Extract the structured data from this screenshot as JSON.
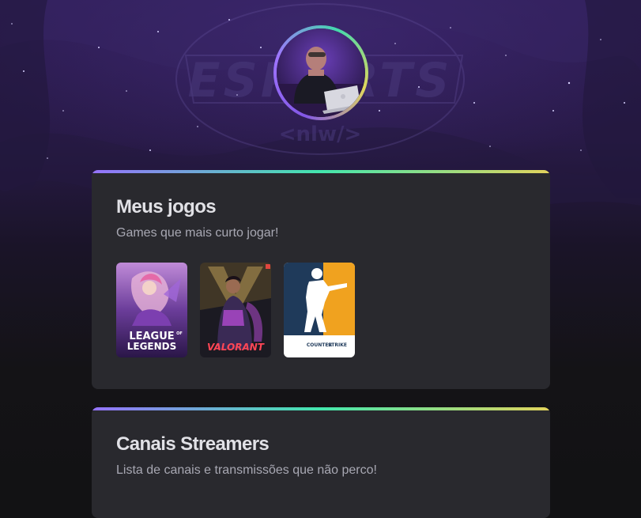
{
  "background": {
    "logo_text": "ESPORTS",
    "logo_sub": "<nlw/>"
  },
  "profile": {
    "avatar_alt": "avatar"
  },
  "colors": {
    "accent_purple": "#8257e5",
    "accent_green": "#43e7ad",
    "accent_yellow": "#e2d45c",
    "card_bg": "#29292e",
    "page_bg": "#121214"
  },
  "sections": [
    {
      "title": "Meus jogos",
      "subtitle": "Games que mais curto jogar!",
      "games": [
        {
          "name": "League of Legends",
          "line1": "LEAGUE",
          "of": "OF",
          "line2": "LEGENDS"
        },
        {
          "name": "Valorant",
          "label": "VALORANT"
        },
        {
          "name": "Counter-Strike",
          "line1": "COUNTER",
          "line2": "STRIKE"
        }
      ]
    },
    {
      "title": "Canais Streamers",
      "subtitle": "Lista de canais e transmissões que não perco!"
    }
  ]
}
